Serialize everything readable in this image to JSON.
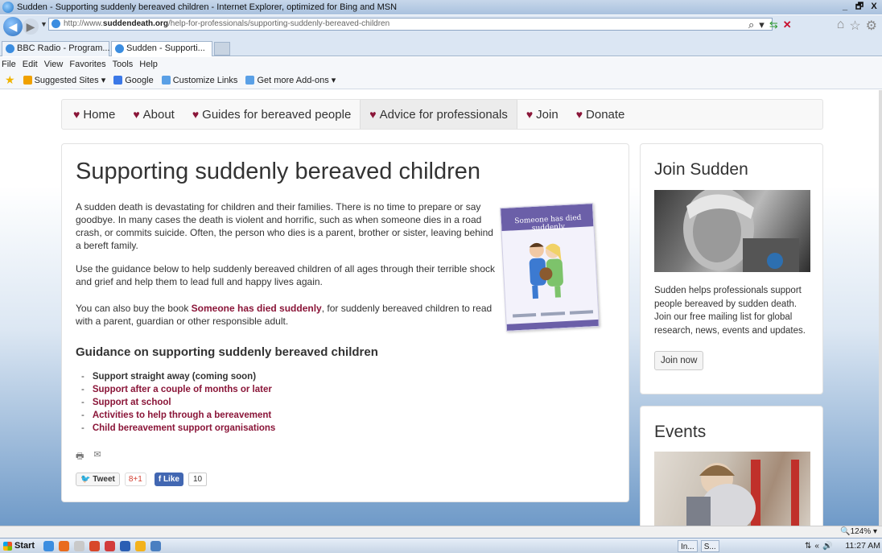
{
  "window": {
    "title": "Sudden - Supporting suddenly bereaved children - Internet Explorer, optimized for Bing and MSN",
    "buttons": [
      "_",
      "🗗",
      "X"
    ]
  },
  "address_bar": {
    "url_prefix": "http://www.",
    "url_domain": "suddendeath.org",
    "url_path": "/help-for-professionals/supporting-suddenly-bereaved-children"
  },
  "tabs": [
    {
      "label": "BBC Radio - Program...",
      "active": false
    },
    {
      "label": "Sudden - Supporti...",
      "active": true,
      "close": "×"
    }
  ],
  "menubar": [
    "File",
    "Edit",
    "View",
    "Favorites",
    "Tools",
    "Help"
  ],
  "favorites_bar": {
    "items": [
      "Suggested Sites ▾",
      "Google",
      "Customize Links",
      "Get more Add-ons ▾"
    ]
  },
  "site_nav": [
    {
      "label": "Home",
      "active": false
    },
    {
      "label": "About",
      "active": false
    },
    {
      "label": "Guides for bereaved people",
      "active": false
    },
    {
      "label": "Advice for professionals",
      "active": true
    },
    {
      "label": "Join",
      "active": false
    },
    {
      "label": "Donate",
      "active": false
    }
  ],
  "article": {
    "title": "Supporting suddenly bereaved children",
    "paragraph1": "A sudden death is devastating for children and their families. There is no time to prepare or say goodbye. In many cases the death is violent and horrific, such as when someone dies in a road crash, or commits suicide. Often, the person who dies is a parent, brother or sister, leaving behind a bereft family.",
    "paragraph2": "Use the guidance below to help suddenly bereaved children of all ages through their terrible shock and grief and help them to lead full and happy lives again.",
    "paragraph3_before": "You can also buy the book ",
    "paragraph3_link": "Someone has died suddenly",
    "paragraph3_after": ", for suddenly bereaved children to read with a parent, guardian or other responsible adult.",
    "book_cover_title": "Someone has died suddenly",
    "guidance_heading": "Guidance on supporting suddenly bereaved children",
    "guidance_items": [
      {
        "label": "Support straight away (coming soon)",
        "link": false
      },
      {
        "label": "Support after a couple of months or later",
        "link": true
      },
      {
        "label": "Support at school",
        "link": true
      },
      {
        "label": "Activities to help through a bereavement",
        "link": true
      },
      {
        "label": "Child bereavement support organisations",
        "link": true
      }
    ],
    "social": {
      "tweet": "Tweet",
      "gplus": "8+1",
      "fb_like": "Like",
      "fb_count": "10"
    }
  },
  "sidebar": {
    "join_title": "Join Sudden",
    "join_text": "Sudden helps professionals support people bereaved by sudden death. Join our free mailing list for global research, news, events and updates.",
    "join_button": "Join now",
    "events_title": "Events"
  },
  "status_bar": {
    "zoom": "124%"
  },
  "taskbar": {
    "start": "Start",
    "tasks": [
      "In...",
      "S..."
    ],
    "clock": "11:27 AM"
  },
  "colors": {
    "accent": "#8a1538",
    "page_gradient_bottom": "#6f9ac8"
  }
}
